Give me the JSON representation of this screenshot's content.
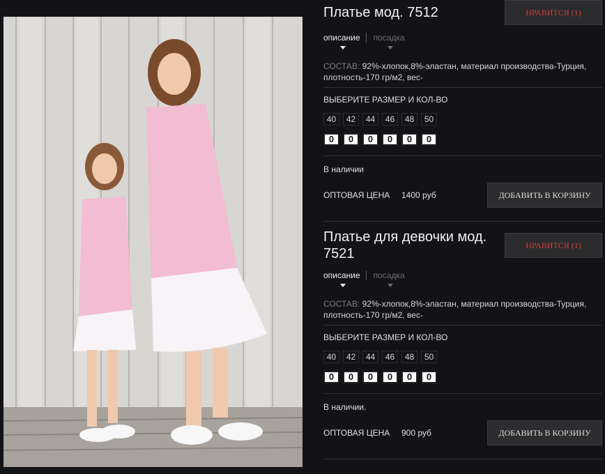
{
  "colors": {
    "background": "#131216",
    "like_text": "#c6403e",
    "button_bg": "#2b2b2d"
  },
  "photo": {
    "alt": ""
  },
  "products": [
    {
      "title": "Платье мод. 7512",
      "like_label": "НРАВИТСЯ (1)",
      "tabs": [
        "описание",
        "посадка"
      ],
      "composition_label": "СОСТАВ:",
      "composition_text": " 92%-хлопок,8%-эластан, материал производства-Турция, плотность-170 гр/м2, вес-",
      "size_heading": "ВЫБЕРИТЕ РАЗМЕР И КОЛ-ВО",
      "sizes": [
        "40",
        "42",
        "44",
        "46",
        "48",
        "50"
      ],
      "quantities": [
        "0",
        "0",
        "0",
        "0",
        "0",
        "0"
      ],
      "stock": "В наличии",
      "price_label": "ОПТОВАЯ ЦЕНА",
      "price": "1400 руб",
      "cart_label": "ДОБАВИТЬ В КОРЗИНУ"
    },
    {
      "title": "Платье для девочки мод. 7521",
      "like_label": "НРАВИТСЯ (1)",
      "tabs": [
        "описание",
        "посадка"
      ],
      "composition_label": "СОСТАВ:",
      "composition_text": " 92%-хлопок,8%-эластан, материал производства-Турция, плотность-170 гр/м2, вес-",
      "size_heading": "ВЫБЕРИТЕ РАЗМЕР И КОЛ-ВО",
      "sizes": [
        "40",
        "42",
        "44",
        "46",
        "48",
        "50"
      ],
      "quantities": [
        "0",
        "0",
        "0",
        "0",
        "0",
        "0"
      ],
      "stock": "В наличии.",
      "price_label": "ОПТОВАЯ ЦЕНА",
      "price": "900 руб",
      "cart_label": "ДОБАВИТЬ В КОРЗИНУ"
    }
  ]
}
